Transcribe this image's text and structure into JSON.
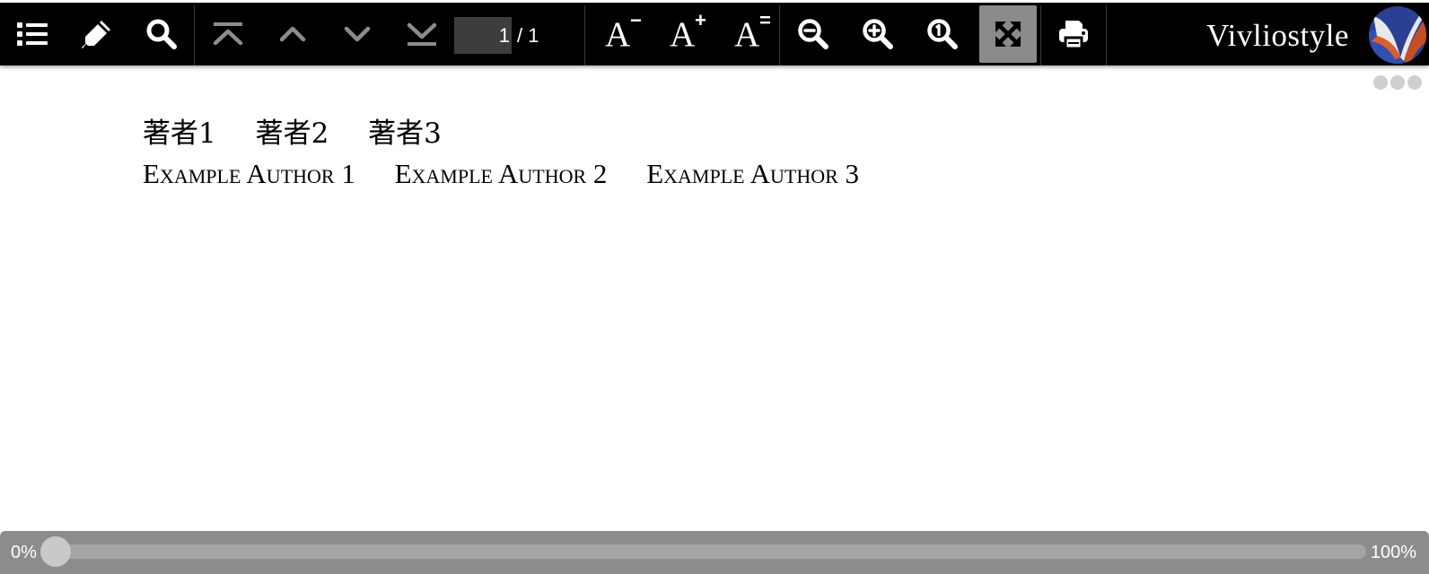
{
  "toolbar": {
    "page_input_value": "1",
    "page_total": "/ 1",
    "buttons": {
      "toc": {
        "icon": "list-icon"
      },
      "marker": {
        "icon": "marker-pen-icon"
      },
      "search": {
        "icon": "search-icon"
      },
      "first_page": {
        "icon": "first-page-icon"
      },
      "prev_page": {
        "icon": "chevron-up-icon"
      },
      "next_page": {
        "icon": "chevron-down-icon"
      },
      "last_page": {
        "icon": "last-page-icon"
      },
      "font_smaller": {
        "label": "A",
        "sup": "−"
      },
      "font_larger": {
        "label": "A",
        "sup": "+"
      },
      "font_default": {
        "label": "A",
        "sup": "="
      },
      "zoom_out": {
        "icon": "zoom-out-icon"
      },
      "zoom_in": {
        "icon": "zoom-in-icon"
      },
      "zoom_actual": {
        "icon": "zoom-actual-size-icon"
      },
      "fit_to_screen": {
        "icon": "fullscreen-icon",
        "active": true
      },
      "print": {
        "icon": "print-icon"
      }
    },
    "brand": "Vivliostyle"
  },
  "content": {
    "authors_ja": [
      "著者1",
      "著者2",
      "著者3"
    ],
    "authors_en": [
      "Example Author 1",
      "Example Author 2",
      "Example Author 3"
    ]
  },
  "progress": {
    "start_label": "0%",
    "end_label": "100%",
    "value": 0
  },
  "colors": {
    "toolbar_bg": "#000000",
    "icon": "#ffffff",
    "icon_disabled": "#8c8c8c",
    "active_button_bg": "#8a8a8a",
    "progress_bg": "#8c8c8c",
    "logo_blue": "#2b3f94",
    "logo_orange": "#d9602c"
  }
}
